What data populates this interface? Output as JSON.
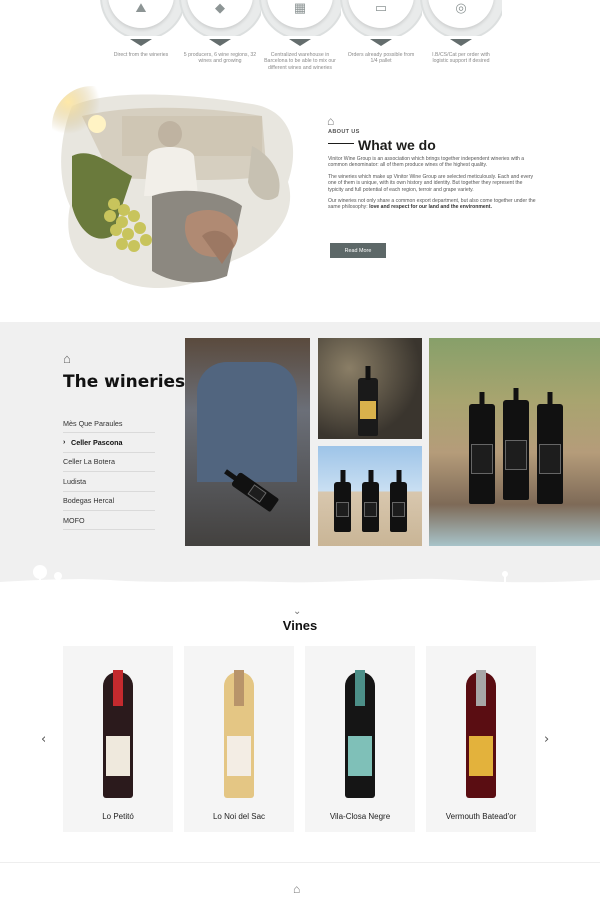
{
  "features": [
    {
      "icon": "vineyard-icon",
      "glyph": "⛰",
      "text": "Direct from the wineries"
    },
    {
      "icon": "map-icon",
      "glyph": "◆",
      "text": "5 producers, 6 wine regions, 32 wines and growing"
    },
    {
      "icon": "warehouse-icon",
      "glyph": "▦",
      "text": "Centralized warehouse in Barcelona to be able to mix our different wines and wineries"
    },
    {
      "icon": "pallet-icon",
      "glyph": "▭",
      "text": "Orders already possible from 1/4 pallet"
    },
    {
      "icon": "truck-icon",
      "glyph": "◎",
      "text": "I.B/CS/Cat per order with logistic support if desired"
    }
  ],
  "what_we_do": {
    "label": "ABOUT US",
    "title": "What we do",
    "p1": "Vinitor Wine Group is an association which brings together independent wineries with a common denominator: all of them produce wines of the highest quality.",
    "p2": "The wineries which make up Vinitor Wine Group are selected meticulously. Each and every one of them is unique, with its own history and identity. But together they represent the typicity and full potential of each region, terroir and grape variety.",
    "p3_a": "Our wineries not only share a common export department, but also come together under the same philosophy: ",
    "p3_b": "love and respect for our land and the environment.",
    "button": "Read More"
  },
  "wineries": {
    "title": "The wineries",
    "items": [
      "Mès Que Paraules",
      "Celler Pascona",
      "Celler La Botera",
      "Ludista",
      "Bodegas Hercal",
      "MOFO"
    ],
    "active_index": 1
  },
  "vines": {
    "title": "Vines",
    "prev": "‹",
    "next": "›",
    "products": [
      {
        "name": "Lo Petitó",
        "bottle": "#2b1a1c",
        "cap": "#c42a2e",
        "label": "#efe9dd"
      },
      {
        "name": "Lo Noi del Sac",
        "bottle": "#e4c684",
        "cap": "#b8946a",
        "label": "#f3ede4"
      },
      {
        "name": "Vila-Closa Negre",
        "bottle": "#151515",
        "cap": "#4c8f88",
        "label": "#7fc0b8"
      },
      {
        "name": "Vermouth Batead'or",
        "bottle": "#5a0d12",
        "cap": "#a7a7a7",
        "label": "#e3b23c"
      }
    ]
  },
  "colors": {
    "accent": "#5d6868",
    "panel": "#f0f0f0"
  }
}
